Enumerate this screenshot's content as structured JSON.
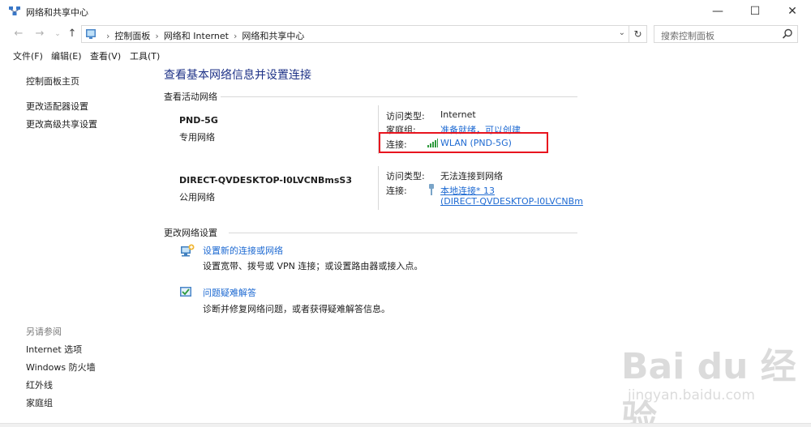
{
  "window": {
    "title": "网络和共享中心"
  },
  "address": {
    "crumbs": [
      "控制面板",
      "网络和 Internet",
      "网络和共享中心"
    ],
    "search_placeholder": "搜索控制面板"
  },
  "menu": [
    "文件(F)",
    "编辑(E)",
    "查看(V)",
    "工具(T)"
  ],
  "sidebar": {
    "items": [
      "控制面板主页",
      "更改适配器设置",
      "更改高级共享设置"
    ],
    "see_also_label": "另请参阅",
    "see_also": [
      "Internet 选项",
      "Windows 防火墙",
      "红外线",
      "家庭组"
    ]
  },
  "main": {
    "title": "查看基本网络信息并设置连接",
    "active_networks_label": "查看活动网络",
    "networks": [
      {
        "name": "PND-5G",
        "type": "专用网络",
        "access_label": "访问类型:",
        "access_value": "Internet",
        "homegroup_label": "家庭组:",
        "homegroup_value": "准备就绪，可以创建",
        "connection_label": "连接:",
        "connection_value": "WLAN (PND-5G)"
      },
      {
        "name": "DIRECT-QVDESKTOP-I0LVCNBmsS3",
        "type": "公用网络",
        "access_label": "访问类型:",
        "access_value": "无法连接到网络",
        "connection_label": "连接:",
        "connection_value_line1": "本地连接* 13",
        "connection_value_line2": "(DIRECT-QVDESKTOP-I0LVCNBm"
      }
    ],
    "change_settings_label": "更改网络设置",
    "tasks": [
      {
        "link": "设置新的连接或网络",
        "desc": "设置宽带、拨号或 VPN 连接；或设置路由器或接入点。"
      },
      {
        "link": "问题疑难解答",
        "desc": "诊断并修复网络问题，或者获得疑难解答信息。"
      }
    ]
  },
  "watermark": {
    "line1": "Bai du 经验",
    "line2": "jingyan.baidu.com"
  },
  "colors": {
    "link": "#1e6ad2",
    "title": "#1e3287",
    "highlight": "#e8141e"
  }
}
